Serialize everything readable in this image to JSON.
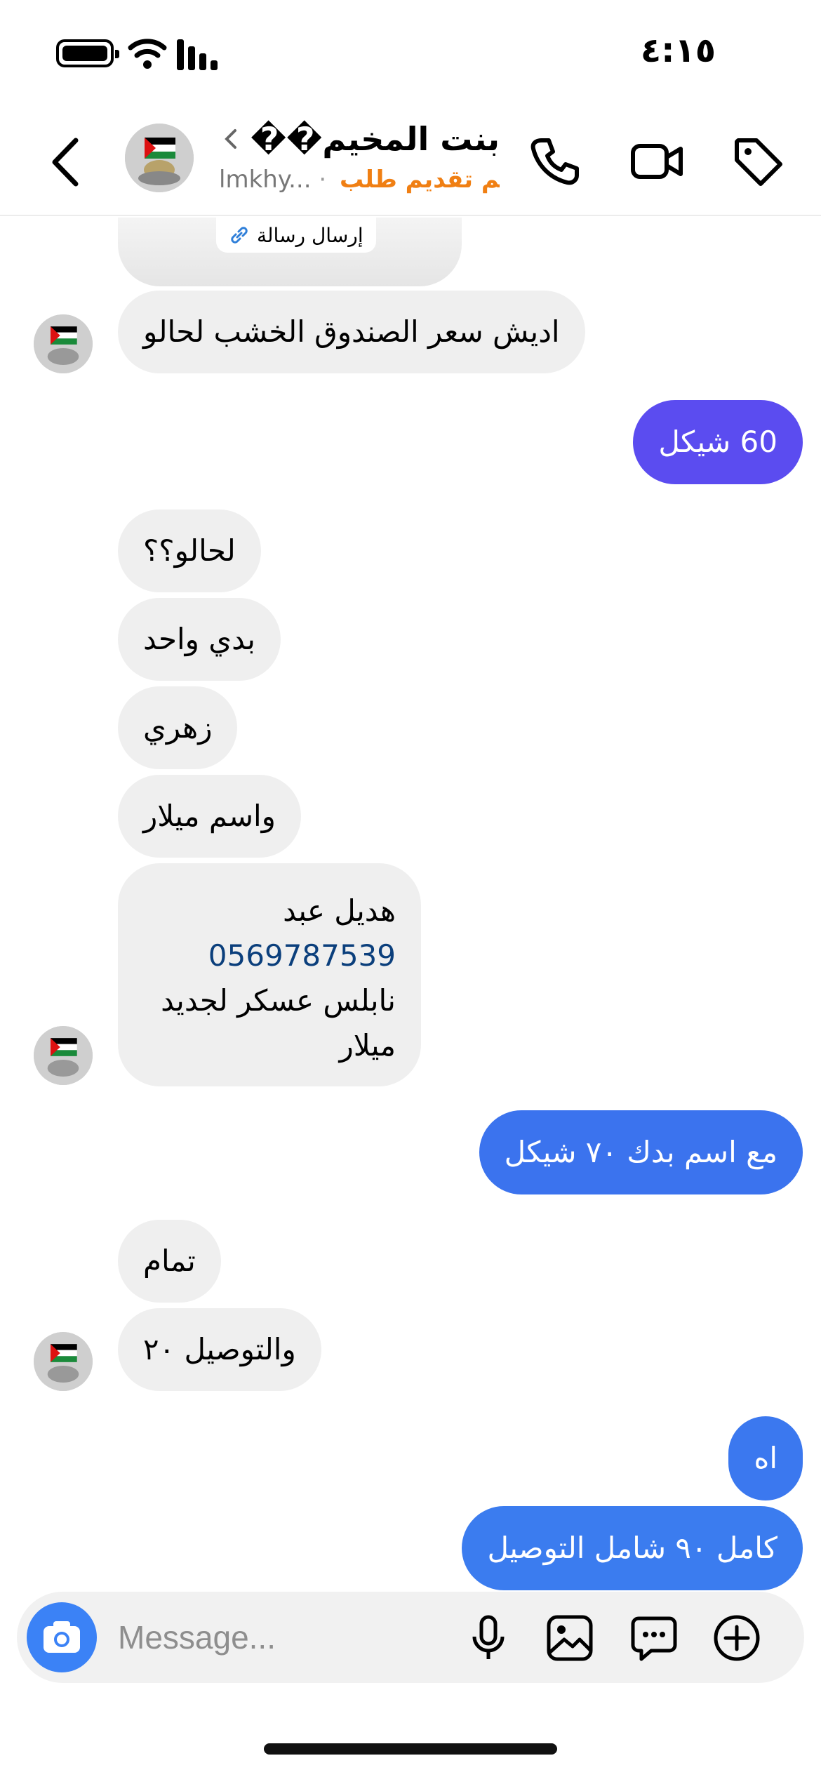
{
  "status_bar": {
    "time": "٤:١٥"
  },
  "header": {
    "name": "بنت المخيم��",
    "username": "lmkhy...",
    "status_label": "تم تقديم طلب"
  },
  "chat": {
    "card_link_label": "إرسال رسالة",
    "messages": [
      {
        "dir": "in",
        "text": "اديش سعر الصندوق الخشب لحالو"
      },
      {
        "dir": "out",
        "text": "60 شيكل",
        "color": "#5b4cf0"
      },
      {
        "dir": "in",
        "text": "لحالو؟؟"
      },
      {
        "dir": "in",
        "text": "بدي واحد"
      },
      {
        "dir": "in",
        "text": "زهري"
      },
      {
        "dir": "in",
        "text": "واسم ميلار"
      },
      {
        "dir": "in",
        "lines": [
          "هديل عبد",
          "0569787539",
          "نابلس عسكر لجديد",
          "ميلار"
        ]
      },
      {
        "dir": "out",
        "text": "مع اسم بدك ٧٠ شيكل",
        "color": "#3b73ee"
      },
      {
        "dir": "in",
        "text": "تمام"
      },
      {
        "dir": "in",
        "text": "والتوصيل ٢٠"
      },
      {
        "dir": "out",
        "text": "اه",
        "color": "#3b78ef"
      },
      {
        "dir": "out",
        "text": "كامل ٩٠ شامل التوصيل",
        "color": "#3b7cef"
      }
    ]
  },
  "composer": {
    "placeholder": "Message..."
  },
  "colors": {
    "camera_button": "#3b82f6",
    "status_label": "#f07f13",
    "phone_link": "#0b3f7c"
  }
}
